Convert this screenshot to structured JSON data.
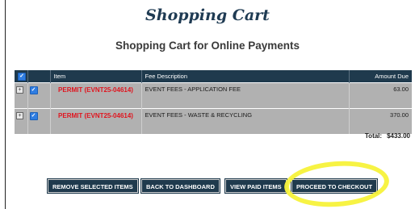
{
  "page": {
    "title": "Shopping Cart",
    "subtitle": "Shopping Cart for Online Payments"
  },
  "table": {
    "columns": [
      "Item",
      "Fee Description",
      "Amount Due"
    ],
    "rows": [
      {
        "item": "PERMIT (EVNT25-04614)",
        "fee_description": "EVENT FEES - APPLICATION FEE",
        "amount_due": "63.00",
        "selected": true
      },
      {
        "item": "PERMIT (EVNT25-04614)",
        "fee_description": "EVENT FEES - WASTE & RECYCLING",
        "amount_due": "370.00",
        "selected": true
      }
    ],
    "total_label": "Total:",
    "total_value": "$433.00"
  },
  "buttons": {
    "remove_selected": "REMOVE SELECTED ITEMS",
    "back_to_dashboard": "BACK TO DASHBOARD",
    "view_paid_items": "VIEW PAID ITEMS",
    "proceed_to_checkout": "PROCEED TO CHECKOUT"
  },
  "icons": {
    "checkbox": "checkbox-checked-icon",
    "expand": "expand-plus-icon"
  },
  "colors": {
    "header_bg": "#1f3a4d",
    "row_bg": "#b1b1b1",
    "item_text": "#e0141e",
    "title": "#1f3b53",
    "highlight": "#f7f23a"
  }
}
